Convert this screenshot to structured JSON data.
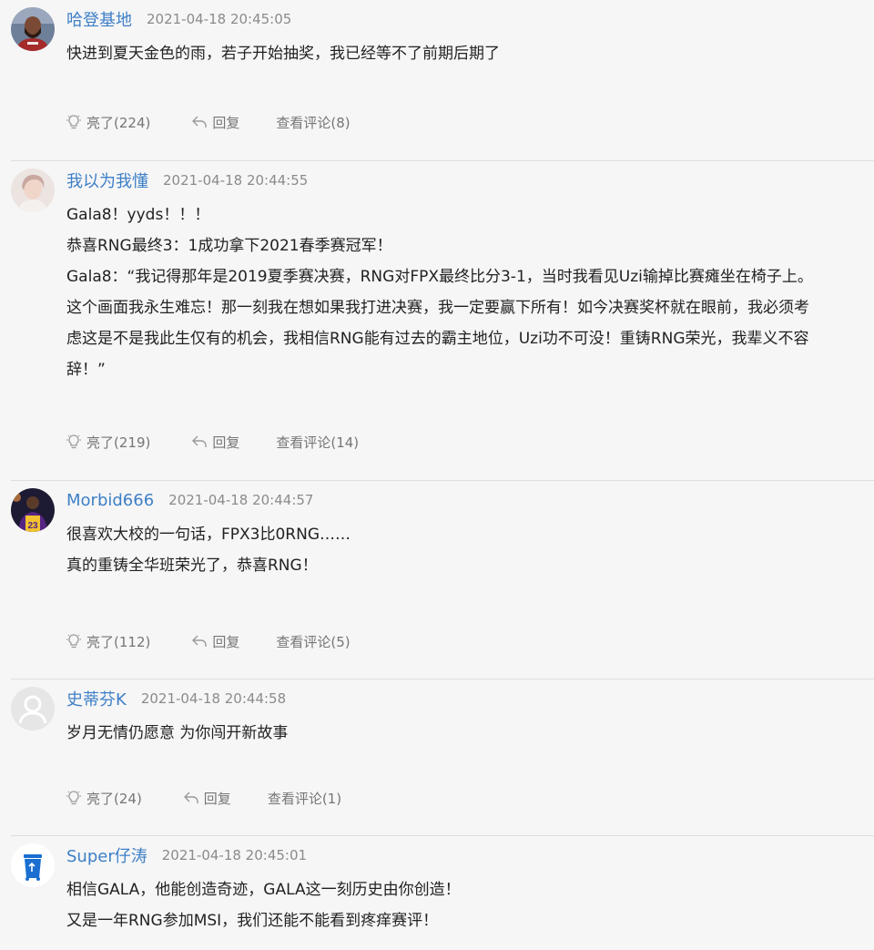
{
  "labels": {
    "reply": "回复"
  },
  "colors": {
    "username": "#3e7fc7",
    "divider": "#dedede",
    "background": "#f6f6f6"
  },
  "comments": [
    {
      "username": "哈登基地",
      "time": "2021-04-18 20:45:05",
      "avatar": "avatar-photo-player",
      "lines": [
        "快进到夏天金色的雨，若子开始抽奖，我已经等不了前期后期了"
      ],
      "likes": "亮了(224)",
      "view": "查看评论(8)"
    },
    {
      "username": "我以为我懂",
      "time": "2021-04-18 20:44:55",
      "avatar": "avatar-photo-person",
      "lines": [
        "Gala8！yyds！！！",
        "恭喜RNG最终3：1成功拿下2021春季赛冠军！",
        "Gala8：“我记得那年是2019夏季赛决赛，RNG对FPX最终比分3-1，当时我看见Uzi输掉比赛瘫坐在椅子上。",
        "这个画面我永生难忘！那一刻我在想如果我打进决赛，我一定要赢下所有！如今决赛奖杯就在眼前，我必须考",
        "虑这是不是我此生仅有的机会，我相信RNG能有过去的霸主地位，Uzi功不可没！重铸RNG荣光，我辈义不容",
        "辞！”"
      ],
      "likes": "亮了(219)",
      "view": "查看评论(14)"
    },
    {
      "username": "Morbid666",
      "time": "2021-04-18 20:44:57",
      "avatar": "avatar-photo-lakers",
      "lines": [
        "很喜欢大校的一句话，FPX3比0RNG……",
        "真的重铸全华班荣光了，恭喜RNG！"
      ],
      "likes": "亮了(112)",
      "view": "查看评论(5)"
    },
    {
      "username": "史蒂芬K",
      "time": "2021-04-18 20:44:58",
      "avatar": "avatar-default-icon",
      "lines": [
        "岁月无情仍愿意 为你闯开新故事"
      ],
      "likes": "亮了(24)",
      "view": "查看评论(1)"
    },
    {
      "username": "Super仔涛",
      "time": "2021-04-18 20:45:01",
      "avatar": "avatar-recycle-bin",
      "lines": [
        "相信GALA，他能创造奇迹，GALA这一刻历史由你创造！",
        "又是一年RNG参加MSI，我们还能不能看到疼痒赛评！"
      ]
    }
  ]
}
